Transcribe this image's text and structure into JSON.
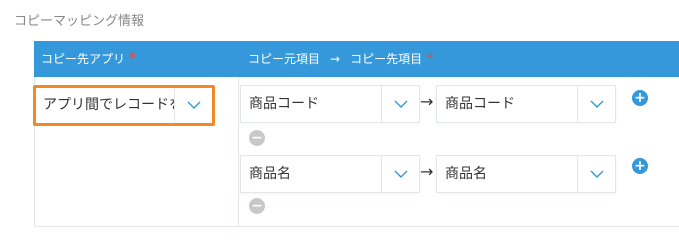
{
  "section_title": "コピーマッピング情報",
  "header": {
    "col_app_label": "コピー先アプリ",
    "col_map_source": "コピー元項目",
    "col_map_arrow": "→",
    "col_map_target": "コピー先項目",
    "required_mark": "*"
  },
  "app_select": {
    "value": "アプリ間でレコードを"
  },
  "mappings": [
    {
      "source": "商品コード",
      "arrow": "→",
      "target": "商品コード",
      "add": "+",
      "remove": "−"
    },
    {
      "source": "商品名",
      "arrow": "→",
      "target": "商品名",
      "add": "+",
      "remove": "−"
    }
  ],
  "colors": {
    "header_bg": "#3498db",
    "required": "#e74c3c",
    "highlight_border": "#f08a24",
    "caret": "#3498db",
    "add_button": "#3498db",
    "remove_button": "#c8c8c8"
  },
  "icons": {
    "caret": "chevron-down-icon",
    "add": "plus-circle-icon",
    "remove": "minus-circle-icon"
  }
}
